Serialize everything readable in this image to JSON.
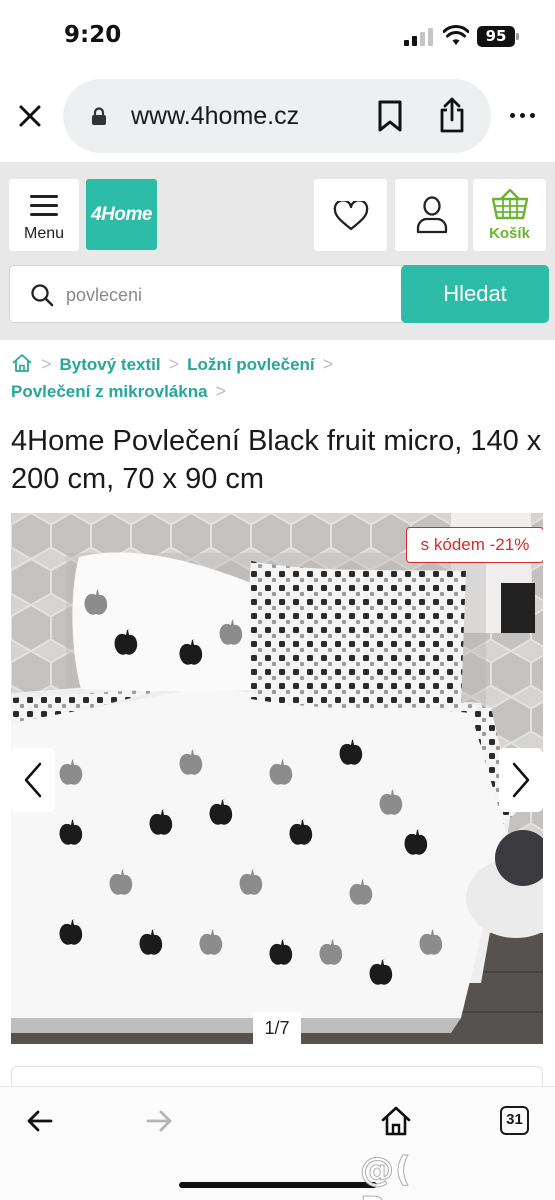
{
  "status_bar": {
    "time": "9:20",
    "battery": "95"
  },
  "browser": {
    "url": "www.4home.cz"
  },
  "header": {
    "menu_label": "Menu",
    "logo_text": "4Home",
    "cart_label": "Košík",
    "search_placeholder": "povleceni",
    "search_button": "Hledat",
    "accent_color": "#2dbca8",
    "cart_color": "#6ab432"
  },
  "breadcrumbs": [
    "Bytový textil",
    "Ložní povlečení",
    "Povlečení z mikrovlákna"
  ],
  "product": {
    "title": "4Home Povlečení Black fruit micro, 140 x 200 cm, 70 x 90 cm",
    "badge": "s kódem -21%",
    "badge_color": "#d62b2b",
    "gallery_counter": "1/7"
  },
  "icons": [
    "close-icon",
    "lock-icon",
    "bookmark-icon",
    "share-icon",
    "more-icon",
    "menu-icon",
    "heart-icon",
    "user-icon",
    "basket-icon",
    "search-icon",
    "home-icon",
    "chevron-left-icon",
    "chevron-right-icon",
    "back-arrow-icon",
    "forward-arrow-icon"
  ],
  "toolbar": {
    "tabs_count": "31"
  },
  "watermark": "@( Bazos.cz"
}
